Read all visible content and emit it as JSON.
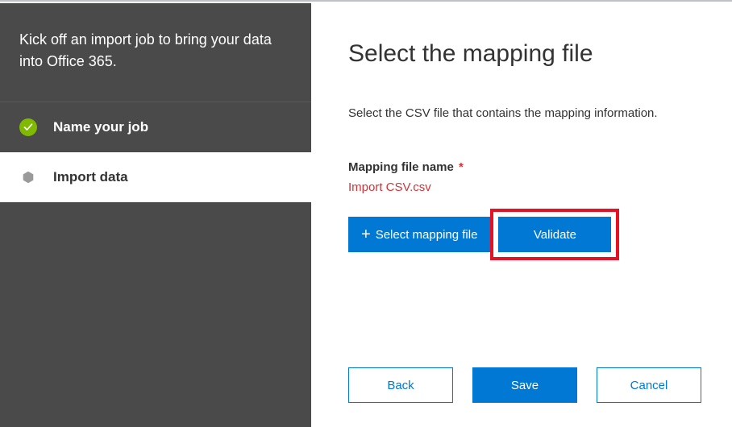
{
  "sidebar": {
    "intro": "Kick off an import job to bring your data into Office 365.",
    "steps": [
      {
        "label": "Name your job",
        "status": "completed"
      },
      {
        "label": "Import data",
        "status": "current"
      }
    ]
  },
  "main": {
    "title": "Select the mapping file",
    "instruction": "Select the CSV file that contains the mapping information.",
    "field_label": "Mapping file name",
    "required_mark": "*",
    "file_value": "Import CSV.csv",
    "select_button": "Select mapping file",
    "validate_button": "Validate"
  },
  "footer": {
    "back": "Back",
    "save": "Save",
    "cancel": "Cancel"
  },
  "colors": {
    "primary": "#0078d4",
    "sidebar_bg": "#4a4a4a",
    "success": "#7fba00",
    "danger": "#d13438",
    "highlight_border": "#e81123"
  }
}
